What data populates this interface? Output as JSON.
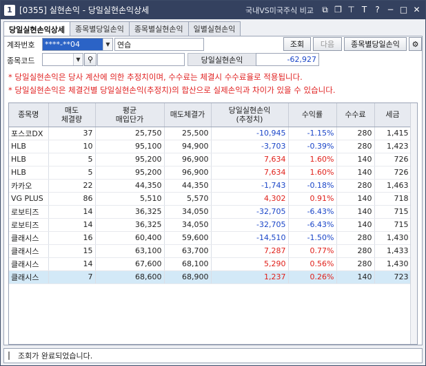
{
  "window": {
    "number": "1",
    "title": "[0355] 실현손익 - 당일실현손익상세",
    "link": "국내VS미국주식 비교"
  },
  "tabs": [
    {
      "label": "당일실현손익상세",
      "active": true
    },
    {
      "label": "종목별당일손익",
      "active": false
    },
    {
      "label": "종목별실현손익",
      "active": false
    },
    {
      "label": "일별실현손익",
      "active": false
    }
  ],
  "form": {
    "account_label": "계좌번호",
    "account_value": "****-**04",
    "account_name": "연습",
    "code_label": "종목코드",
    "code_value": "",
    "profit_label": "당일실현손익",
    "profit_value": "-62,927",
    "btn_query": "조회",
    "btn_next": "다음",
    "btn_by_stock": "종목별당일손익"
  },
  "notes": [
    "* 당일실현손익은 당사 계산에 의한 추정치이며, 수수료는 체결시 수수료율로 적용됩니다.",
    "* 당일실현손익은 체결건별 당일실현손익(추정치)의 합산으로 실제손익과 차이가 있을 수 있습니다."
  ],
  "table": {
    "headers": [
      {
        "l1": "종목명",
        "l2": ""
      },
      {
        "l1": "매도",
        "l2": "체결량"
      },
      {
        "l1": "평균",
        "l2": "매입단가"
      },
      {
        "l1": "매도체결가",
        "l2": ""
      },
      {
        "l1": "당일실현손익",
        "l2": "(추정치)"
      },
      {
        "l1": "수익률",
        "l2": ""
      },
      {
        "l1": "수수료",
        "l2": ""
      },
      {
        "l1": "세금",
        "l2": ""
      }
    ],
    "rows": [
      {
        "name": "포스코DX",
        "qty": "37",
        "avg": "25,750",
        "sell": "25,500",
        "pnl": "-10,945",
        "rate": "-1.15%",
        "fee": "280",
        "tax": "1,415",
        "sign": "neg"
      },
      {
        "name": "HLB",
        "qty": "10",
        "avg": "95,100",
        "sell": "94,900",
        "pnl": "-3,703",
        "rate": "-0.39%",
        "fee": "280",
        "tax": "1,423",
        "sign": "neg"
      },
      {
        "name": "HLB",
        "qty": "5",
        "avg": "95,200",
        "sell": "96,900",
        "pnl": "7,634",
        "rate": "1.60%",
        "fee": "140",
        "tax": "726",
        "sign": "pos"
      },
      {
        "name": "HLB",
        "qty": "5",
        "avg": "95,200",
        "sell": "96,900",
        "pnl": "7,634",
        "rate": "1.60%",
        "fee": "140",
        "tax": "726",
        "sign": "pos"
      },
      {
        "name": "카카오",
        "qty": "22",
        "avg": "44,350",
        "sell": "44,350",
        "pnl": "-1,743",
        "rate": "-0.18%",
        "fee": "280",
        "tax": "1,463",
        "sign": "neg"
      },
      {
        "name": "VG PLUS",
        "qty": "86",
        "avg": "5,510",
        "sell": "5,570",
        "pnl": "4,302",
        "rate": "0.91%",
        "fee": "140",
        "tax": "718",
        "sign": "pos"
      },
      {
        "name": "로보티즈",
        "qty": "14",
        "avg": "36,325",
        "sell": "34,050",
        "pnl": "-32,705",
        "rate": "-6.43%",
        "fee": "140",
        "tax": "715",
        "sign": "neg"
      },
      {
        "name": "로보티즈",
        "qty": "14",
        "avg": "36,325",
        "sell": "34,050",
        "pnl": "-32,705",
        "rate": "-6.43%",
        "fee": "140",
        "tax": "715",
        "sign": "neg"
      },
      {
        "name": "클래시스",
        "qty": "16",
        "avg": "60,400",
        "sell": "59,600",
        "pnl": "-14,510",
        "rate": "-1.50%",
        "fee": "280",
        "tax": "1,430",
        "sign": "neg"
      },
      {
        "name": "클래시스",
        "qty": "15",
        "avg": "63,100",
        "sell": "63,700",
        "pnl": "7,287",
        "rate": "0.77%",
        "fee": "280",
        "tax": "1,433",
        "sign": "pos"
      },
      {
        "name": "클래시스",
        "qty": "14",
        "avg": "67,600",
        "sell": "68,100",
        "pnl": "5,290",
        "rate": "0.56%",
        "fee": "280",
        "tax": "1,430",
        "sign": "pos"
      },
      {
        "name": "클래시스",
        "qty": "7",
        "avg": "68,600",
        "sell": "68,900",
        "pnl": "1,237",
        "rate": "0.26%",
        "fee": "140",
        "tax": "723",
        "sign": "pos",
        "selected": true
      }
    ]
  },
  "status": "조회가 완료되었습니다.",
  "colors": {
    "titlebar": "#34415f",
    "positive": "#e0201a",
    "negative": "#1a45c8",
    "note": "#e02020",
    "selected_row": "#d3e9f7"
  }
}
